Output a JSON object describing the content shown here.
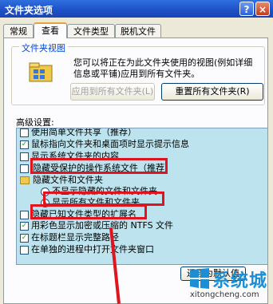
{
  "window": {
    "title": "文件夹选项",
    "help_icon": "?",
    "close_icon": "×"
  },
  "tabs": [
    {
      "label": "常规",
      "active": false
    },
    {
      "label": "查看",
      "active": true
    },
    {
      "label": "文件类型",
      "active": false
    },
    {
      "label": "脱机文件",
      "active": false
    }
  ],
  "folder_view": {
    "title": "文件夹视图",
    "description": "您可以将正在为此文件夹使用的视图(例如详细信息或平铺)应用到所有文件夹。",
    "apply_button": "应用到所有文件夹(L)",
    "reset_button": "重置所有文件夹(R)"
  },
  "advanced": {
    "label": "高级设置:",
    "items": [
      {
        "text": "使用简单文件共享（推荐）",
        "type": "checkbox",
        "checked": false
      },
      {
        "text": "鼠标指向文件夹和桌面项时显示提示信息",
        "type": "checkbox",
        "checked": true
      },
      {
        "text": "显示系统文件夹的内容",
        "type": "checkbox",
        "checked": false
      },
      {
        "text": "隐藏受保护的操作系统文件（推荐）",
        "type": "checkbox",
        "checked": false
      },
      {
        "text": "隐藏文件和文件夹",
        "type": "folder"
      },
      {
        "text": "不显示隐藏的文件和文件夹",
        "type": "radio",
        "checked": false
      },
      {
        "text": "显示所有文件和文件夹",
        "type": "radio",
        "checked": true
      },
      {
        "text": "隐藏已知文件类型的扩展名",
        "type": "checkbox",
        "checked": false
      },
      {
        "text": "用彩色显示加密或压缩的 NTFS 文件",
        "type": "checkbox",
        "checked": true
      },
      {
        "text": "在标题栏显示完整路径",
        "type": "checkbox",
        "checked": true
      },
      {
        "text": "在单独的进程中打开文件夹窗口",
        "type": "checkbox",
        "checked": false
      }
    ],
    "restore_button": "还原为默认值"
  },
  "watermark": {
    "brand": "系统城",
    "url": "xitongcheng.com"
  },
  "colors": {
    "highlight": "#e0141e",
    "list_bg": "#bde3ee",
    "title_bar": "#1d4fc4"
  }
}
